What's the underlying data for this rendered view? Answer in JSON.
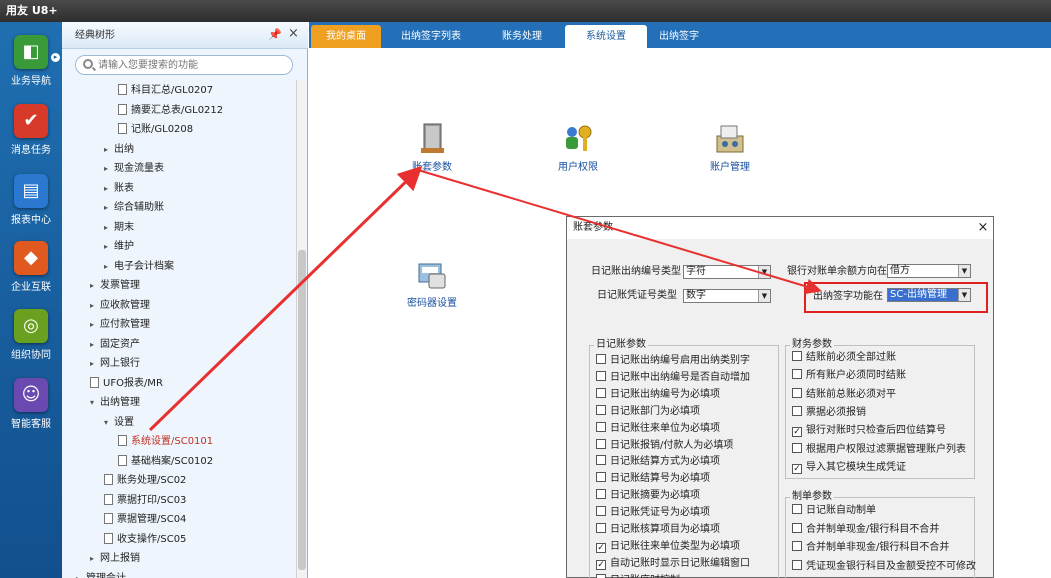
{
  "app": {
    "title": "用友 U8+"
  },
  "left_nav": {
    "items": [
      {
        "label": "业务导航",
        "icon": "business-navigation-icon",
        "color": "#3a9a3a",
        "glyph": "◧"
      },
      {
        "label": "消息任务",
        "icon": "message-task-icon",
        "color": "#d83a2a",
        "glyph": "✔"
      },
      {
        "label": "报表中心",
        "icon": "report-center-icon",
        "color": "#2a78d0",
        "glyph": "▤"
      },
      {
        "label": "企业互联",
        "icon": "enterprise-connect-icon",
        "color": "#e05a20",
        "glyph": "◆"
      },
      {
        "label": "组织协同",
        "icon": "org-collaboration-icon",
        "color": "#6aa020",
        "glyph": "◎"
      },
      {
        "label": "智能客服",
        "icon": "smart-service-icon",
        "color": "#6a4ab0",
        "glyph": "☺"
      }
    ]
  },
  "tree": {
    "title": "经典树形",
    "search_placeholder": "请输入您要搜索的功能",
    "rows": [
      {
        "text": "科目汇总/GL0207",
        "level": 3,
        "type": "doc"
      },
      {
        "text": "摘要汇总表/GL0212",
        "level": 3,
        "type": "doc"
      },
      {
        "text": "记账/GL0208",
        "level": 3,
        "type": "doc"
      },
      {
        "text": "出纳",
        "level": 2,
        "type": "folder"
      },
      {
        "text": "现金流量表",
        "level": 2,
        "type": "folder"
      },
      {
        "text": "账表",
        "level": 2,
        "type": "folder"
      },
      {
        "text": "综合辅助账",
        "level": 2,
        "type": "folder"
      },
      {
        "text": "期末",
        "level": 2,
        "type": "folder"
      },
      {
        "text": "维护",
        "level": 2,
        "type": "folder"
      },
      {
        "text": "电子会计档案",
        "level": 2,
        "type": "folder"
      },
      {
        "text": "发票管理",
        "level": 1,
        "type": "folder"
      },
      {
        "text": "应收款管理",
        "level": 1,
        "type": "folder"
      },
      {
        "text": "应付款管理",
        "level": 1,
        "type": "folder"
      },
      {
        "text": "固定资产",
        "level": 1,
        "type": "folder"
      },
      {
        "text": "网上银行",
        "level": 1,
        "type": "folder"
      },
      {
        "text": "UFO报表/MR",
        "level": 1,
        "type": "doc"
      },
      {
        "text": "出纳管理",
        "level": 1,
        "type": "open"
      },
      {
        "text": "设置",
        "level": 2,
        "type": "open"
      },
      {
        "text": "系统设置/SC0101",
        "level": 3,
        "type": "doc",
        "selected": true
      },
      {
        "text": "基础档案/SC0102",
        "level": 3,
        "type": "doc"
      },
      {
        "text": "账务处理/SC02",
        "level": 2,
        "type": "doc"
      },
      {
        "text": "票据打印/SC03",
        "level": 2,
        "type": "doc"
      },
      {
        "text": "票据管理/SC04",
        "level": 2,
        "type": "doc"
      },
      {
        "text": "收支操作/SC05",
        "level": 2,
        "type": "doc"
      },
      {
        "text": "网上报销",
        "level": 1,
        "type": "folder"
      },
      {
        "text": "管理会计",
        "level": 0,
        "type": "folder"
      }
    ]
  },
  "tabs": [
    {
      "label": "我的桌面"
    },
    {
      "label": "出纳签字列表"
    },
    {
      "label": "账务处理"
    },
    {
      "label": "系统设置"
    },
    {
      "label": "出纳签字"
    }
  ],
  "workspace": {
    "icons": [
      {
        "label": "账套参数",
        "icon": "account-params-icon"
      },
      {
        "label": "用户权限",
        "icon": "user-permission-icon"
      },
      {
        "label": "账户管理",
        "icon": "account-management-icon"
      },
      {
        "label": "密码器设置",
        "icon": "password-device-icon"
      }
    ]
  },
  "dialog": {
    "title": "账套参数",
    "fields": {
      "journal_type_label": "日记账出纳编号类型",
      "journal_type_value": "字符",
      "voucher_type_label": "日记账凭证号类型",
      "voucher_type_value": "数字",
      "balance_dir_label": "银行对账单余额方向在",
      "balance_dir_value": "借方",
      "sign_func_label": "出纳签字功能在",
      "sign_func_value": "SC-出纳管理"
    },
    "journal_group": {
      "title": "日记账参数",
      "items": [
        {
          "label": "日记账出纳编号启用出纳类别字",
          "checked": false
        },
        {
          "label": "日记账中出纳编号是否自动增加",
          "checked": false
        },
        {
          "label": "日记账出纳编号为必填项",
          "checked": false
        },
        {
          "label": "日记账部门为必填项",
          "checked": false
        },
        {
          "label": "日记账往来单位为必填项",
          "checked": false
        },
        {
          "label": "日记账报销/付款人为必填项",
          "checked": false
        },
        {
          "label": "日记账结算方式为必填项",
          "checked": false
        },
        {
          "label": "日记账结算号为必填项",
          "checked": false
        },
        {
          "label": "日记账摘要为必填项",
          "checked": false
        },
        {
          "label": "日记账凭证号为必填项",
          "checked": false
        },
        {
          "label": "日记账核算项目为必填项",
          "checked": false
        },
        {
          "label": "日记账往来单位类型为必填项",
          "checked": true
        },
        {
          "label": "自动记账时显示日记账编辑窗口",
          "checked": true
        },
        {
          "label": "日记账序时控制",
          "checked": false
        }
      ]
    },
    "finance_group": {
      "title": "财务参数",
      "items": [
        {
          "label": "结账前必须全部过账",
          "checked": false
        },
        {
          "label": "所有账户必须同时结账",
          "checked": false
        },
        {
          "label": "结账前总账必须对平",
          "checked": false
        },
        {
          "label": "票据必须报销",
          "checked": false
        },
        {
          "label": "银行对账时只检查后四位结算号",
          "checked": true
        },
        {
          "label": "根据用户权限过滤票据管理账户列表",
          "checked": false
        },
        {
          "label": "导入其它模块生成凭证",
          "checked": true
        }
      ]
    },
    "voucher_group": {
      "title": "制单参数",
      "items": [
        {
          "label": "日记账自动制单",
          "checked": false
        },
        {
          "label": "合并制单现金/银行科目不合并",
          "checked": false
        },
        {
          "label": "合并制单非现金/银行科目不合并",
          "checked": false
        },
        {
          "label": "凭证现金银行科目及金额受控不可修改",
          "checked": false
        }
      ]
    }
  },
  "colors": {
    "accent": "#2470b8",
    "tab_active": "#f0a020",
    "annotation": "#e02020"
  }
}
